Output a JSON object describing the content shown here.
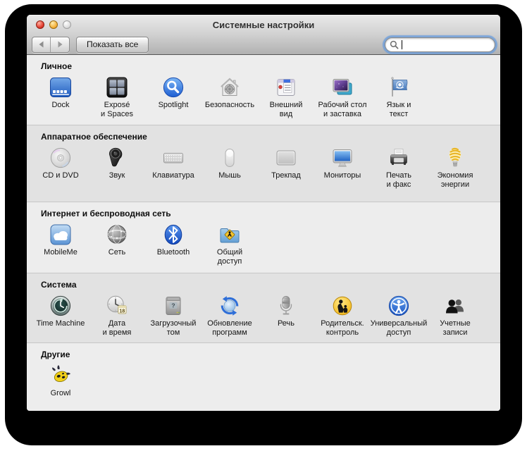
{
  "window": {
    "title": "Системные настройки",
    "traffic_lights": [
      {
        "name": "close",
        "color": "#e23d30"
      },
      {
        "name": "minimize",
        "color": "#f5b23c"
      },
      {
        "name": "zoom",
        "color": "#dcdcdc",
        "state": "disabled"
      }
    ],
    "toolbar": {
      "back_icon": "chevron-left",
      "forward_icon": "chevron-right",
      "show_all_label": "Показать все",
      "search_placeholder": "",
      "search_value": ""
    },
    "sections": [
      {
        "slug": "personal",
        "title": "Личное",
        "items": [
          {
            "label": "Dock",
            "icon": "dock"
          },
          {
            "label": "Exposé\nи Spaces",
            "icon": "expose"
          },
          {
            "label": "Spotlight",
            "icon": "spotlight"
          },
          {
            "label": "Безопасность",
            "icon": "security"
          },
          {
            "label": "Внешний\nвид",
            "icon": "appearance"
          },
          {
            "label": "Рабочий стол\nи заставка",
            "icon": "desktop-screensaver"
          },
          {
            "label": "Язык и\nтекст",
            "icon": "language-text"
          }
        ]
      },
      {
        "slug": "hardware",
        "title": "Аппаратное обеспечение",
        "items": [
          {
            "label": "CD и DVD",
            "icon": "cd-dvd"
          },
          {
            "label": "Звук",
            "icon": "sound"
          },
          {
            "label": "Клавиатура",
            "icon": "keyboard"
          },
          {
            "label": "Мышь",
            "icon": "mouse"
          },
          {
            "label": "Трекпад",
            "icon": "trackpad"
          },
          {
            "label": "Мониторы",
            "icon": "displays"
          },
          {
            "label": "Печать\nи факс",
            "icon": "print-fax"
          },
          {
            "label": "Экономия\nэнергии",
            "icon": "energy-saver"
          }
        ]
      },
      {
        "slug": "internet-wireless",
        "title": "Интернет и беспроводная сеть",
        "items": [
          {
            "label": "MobileMe",
            "icon": "mobileme"
          },
          {
            "label": "Сеть",
            "icon": "network"
          },
          {
            "label": "Bluetooth",
            "icon": "bluetooth"
          },
          {
            "label": "Общий\nдоступ",
            "icon": "sharing"
          }
        ]
      },
      {
        "slug": "system",
        "title": "Система",
        "items": [
          {
            "label": "Time Machine",
            "icon": "time-machine"
          },
          {
            "label": "Дата\nи время",
            "icon": "date-time"
          },
          {
            "label": "Загрузочный\nтом",
            "icon": "startup-disk"
          },
          {
            "label": "Обновление\nпрограмм",
            "icon": "software-update"
          },
          {
            "label": "Речь",
            "icon": "speech"
          },
          {
            "label": "Родительск.\nконтроль",
            "icon": "parental-controls"
          },
          {
            "label": "Универсальный\nдоступ",
            "icon": "universal-access"
          },
          {
            "label": "Учетные\nзаписи",
            "icon": "accounts"
          }
        ]
      },
      {
        "slug": "other",
        "title": "Другие",
        "items": [
          {
            "label": "Growl",
            "icon": "growl"
          }
        ]
      }
    ],
    "colors": {
      "band_light": "#ededed",
      "band_dark": "#e2e2e2",
      "separator": "#c6c6c6",
      "focus_ring_blue": "#6a9cdb",
      "accent_blue": "#2f6fd8"
    }
  }
}
